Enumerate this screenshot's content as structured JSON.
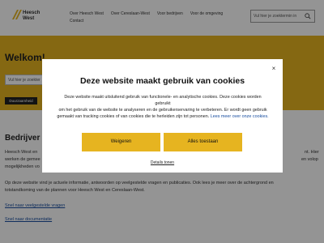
{
  "header": {
    "logo_text": "Heesch\nWest",
    "nav_row1": [
      "Over Heesch West",
      "Over Cereslaan-West",
      "Voor bedrijven",
      "Voor de omgeving"
    ],
    "nav_row2": [
      "Contact"
    ],
    "search_placeholder": "Vul hier je zoektermin in"
  },
  "hero": {
    "title": "Welkom!",
    "search_placeholder": "Vul hier je zoekter",
    "button_label": "Duurzaamheid"
  },
  "main": {
    "title": "Bedrijver",
    "para1_left": "Heesch West en",
    "para1_right": "nt. Hier",
    "para2_left": "werken de gemee",
    "para2_right": "en volop",
    "para3_left": "mogelijkheden vo",
    "para4": "Op deze website vind je actuele informatie, antwoorden op veelgestelde vragen en publicaties. Ook lees je meer over de achtergrond en",
    "para5": "totstandkoming van de plannen voor Heesch West en Cereslaan-West.",
    "link1": "Snel naar veelgestelde vragen",
    "link2": "Snel naar documentatie"
  },
  "modal": {
    "close": "×",
    "title": "Deze website maakt gebruik van cookies",
    "text_line1": "Deze website maakt uitsluitend gebruik van functionele- en analytische cookies. Deze cookies worden gebruikt",
    "text_line2": "om het gebruik van de website te analyseren en de gebruikerservaring te verbeteren. Er wordt geen gebruik",
    "text_line3": "gemaakt van tracking cookies of van cookies die te herleiden zijn tot personen.",
    "text_link": "Lees meer over onze cookies.",
    "refuse_label": "Weigeren",
    "accept_label": "Alles toestaan",
    "details_label": "Details tonen"
  },
  "colors": {
    "accent": "#e6b420",
    "link": "#1a4fa0"
  }
}
